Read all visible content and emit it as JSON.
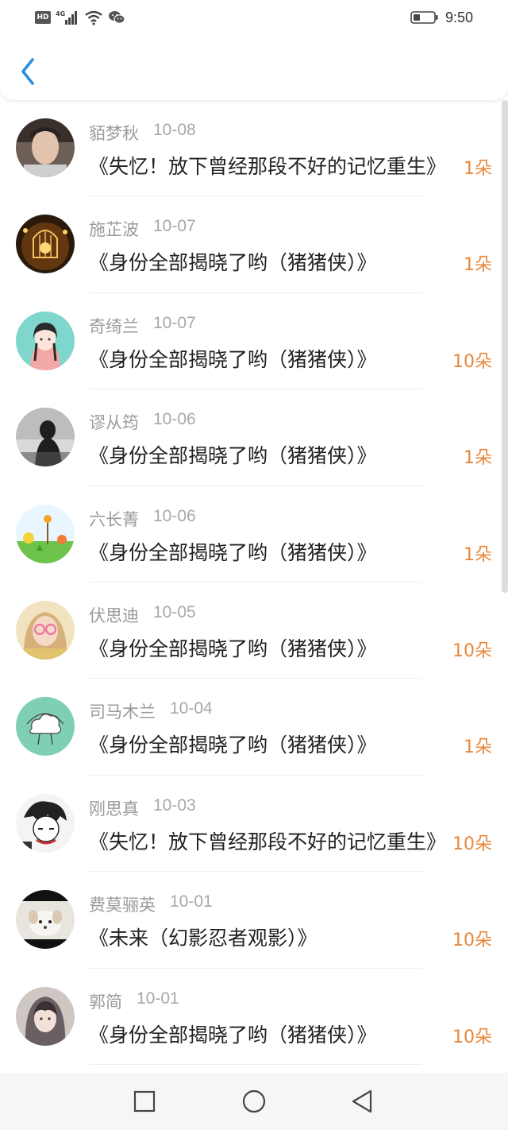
{
  "status_bar": {
    "hd": "HD",
    "network": "4G",
    "time": "9:50"
  },
  "header": {
    "back_icon": "chevron-left-icon"
  },
  "colors": {
    "accent": "#2b8fe0",
    "count": "#e8873a",
    "name": "#9a9a9a"
  },
  "items": [
    {
      "name": "貊梦秋",
      "date": "10-08",
      "title": "《失忆！放下曾经那段不好的记忆重生》",
      "count": "1朵",
      "avatar": "man-portrait"
    },
    {
      "name": "施芷波",
      "date": "10-07",
      "title": "《身份全部揭晓了哟（猪猪侠）》",
      "count": "1朵",
      "avatar": "birdcage-lamp"
    },
    {
      "name": "奇绮兰",
      "date": "10-07",
      "title": "《身份全部揭晓了哟（猪猪侠）》",
      "count": "10朵",
      "avatar": "cartoon-girl"
    },
    {
      "name": "谬从筠",
      "date": "10-06",
      "title": "《身份全部揭晓了哟（猪猪侠）》",
      "count": "1朵",
      "avatar": "girl-silhouette"
    },
    {
      "name": "六长菁",
      "date": "10-06",
      "title": "《身份全部揭晓了哟（猪猪侠）》",
      "count": "1朵",
      "avatar": "flower-field"
    },
    {
      "name": "伏思迪",
      "date": "10-05",
      "title": "《身份全部揭晓了哟（猪猪侠）》",
      "count": "10朵",
      "avatar": "girl-glasses"
    },
    {
      "name": "司马木兰",
      "date": "10-04",
      "title": "《身份全部揭晓了哟（猪猪侠）》",
      "count": "1朵",
      "avatar": "cloud-cartoon"
    },
    {
      "name": "刚思真",
      "date": "10-03",
      "title": "《失忆！放下曾经那段不好的记忆重生》",
      "count": "10朵",
      "avatar": "manga-sketch"
    },
    {
      "name": "费莫骊英",
      "date": "10-01",
      "title": "《未来（幻影忍者观影）》",
      "count": "10朵",
      "avatar": "white-puppy"
    },
    {
      "name": "郭简",
      "date": "10-01",
      "title": "《身份全部揭晓了哟（猪猪侠）》",
      "count": "10朵",
      "avatar": "girl-hood"
    }
  ],
  "nav_bar": {
    "recent_icon": "square-icon",
    "home_icon": "circle-icon",
    "back_icon": "triangle-back-icon"
  }
}
